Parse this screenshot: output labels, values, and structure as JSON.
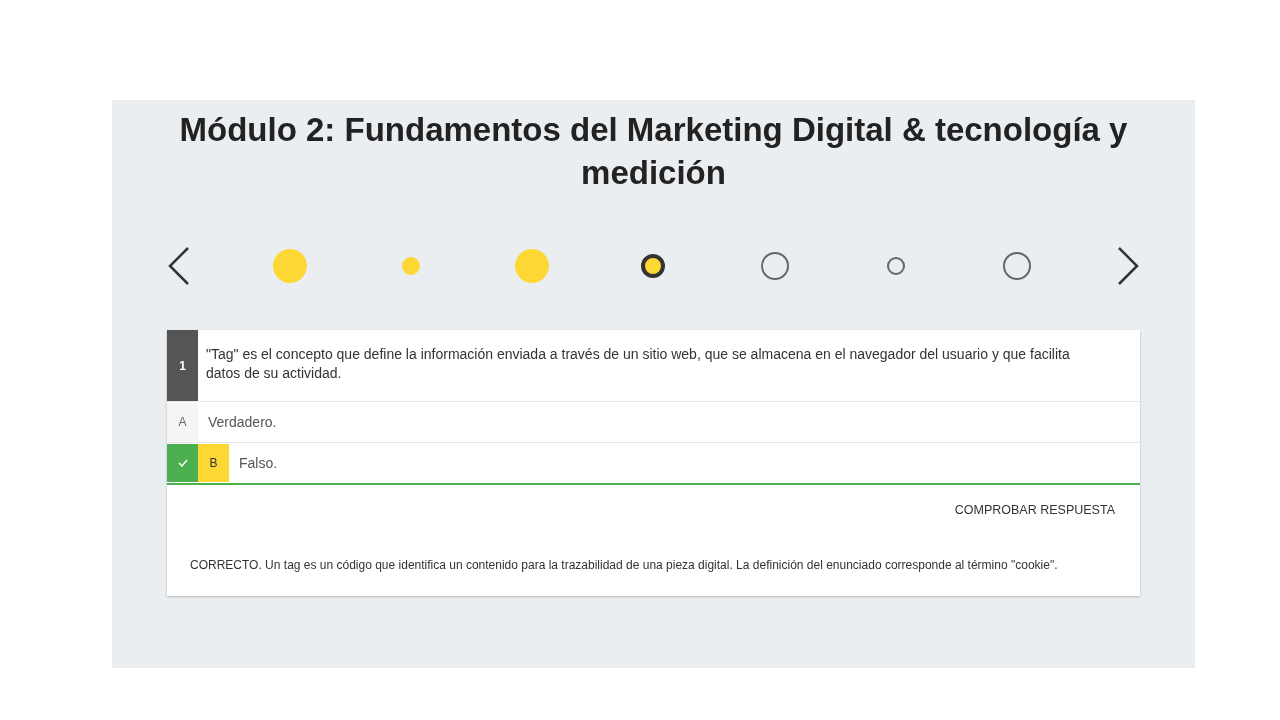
{
  "title": "Módulo 2: Fundamentos del Marketing Digital & tecnología y medición",
  "pager": [
    {
      "answered": true,
      "current": false,
      "small": false
    },
    {
      "answered": true,
      "current": false,
      "small": true
    },
    {
      "answered": true,
      "current": false,
      "small": false
    },
    {
      "answered": false,
      "current": true,
      "small": false
    },
    {
      "answered": false,
      "current": false,
      "small": false
    },
    {
      "answered": false,
      "current": false,
      "small": true
    },
    {
      "answered": false,
      "current": false,
      "small": false
    }
  ],
  "question": {
    "number": "1",
    "text": "\"Tag\" es el concepto que define la información enviada a través de un sitio web, que se almacena en el navegador del usuario y que facilita datos de su actividad.",
    "options": [
      {
        "letter": "A",
        "text": "Verdadero.",
        "selected": false,
        "correct": false
      },
      {
        "letter": "B",
        "text": "Falso.",
        "selected": true,
        "correct": true
      }
    ],
    "check_button": "COMPROBAR RESPUESTA",
    "feedback": "CORRECTO. Un tag es un código que identifica un contenido para la trazabilidad de una pieza digital. La definición del enunciado corresponde al término \"cookie\"."
  }
}
